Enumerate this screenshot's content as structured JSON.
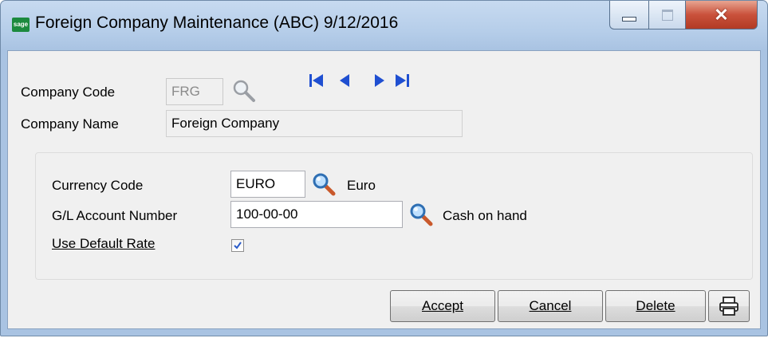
{
  "window": {
    "app_icon_text": "sage",
    "title": "Foreign Company Maintenance (ABC) 9/12/2016"
  },
  "header": {
    "company_code_label": "Company Code",
    "company_code_value": "FRG",
    "company_name_label": "Company Name",
    "company_name_value": "Foreign Company"
  },
  "currency": {
    "currency_code_label": "Currency Code",
    "currency_code_value": "EURO",
    "currency_desc": "Euro",
    "gl_account_label": "G/L Account Number",
    "gl_account_value": "100-00-00",
    "gl_account_desc": "Cash on hand",
    "use_default_rate_label": "Use Default Rate",
    "use_default_rate_checked": true
  },
  "buttons": {
    "accept_label": "Accept",
    "cancel_label": "Cancel",
    "delete_label": "Delete"
  },
  "icons": {
    "lookup": "magnifier-icon",
    "first": "first-record-icon",
    "prev": "previous-record-icon",
    "next": "next-record-icon",
    "last": "last-record-icon",
    "print": "printer-icon"
  },
  "colors": {
    "nav_arrow": "#1f4fd1",
    "titlebar": "#b5cde9",
    "close_button": "#c9513b"
  }
}
